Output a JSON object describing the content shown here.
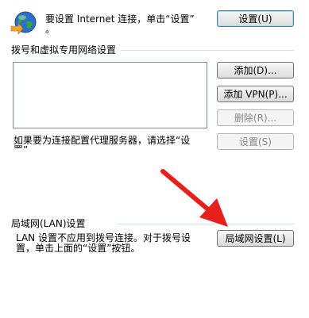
{
  "setup": {
    "text_line1": "要设置 Internet 连接，单击“设置”",
    "text_line2": "。",
    "button": "设置(U)"
  },
  "dialup": {
    "heading": "拨号和虚拟专用网络设置",
    "buttons": {
      "add": "添加(D)...",
      "add_vpn": "添加 VPN(P)...",
      "remove": "删除(R)...",
      "settings": "设置(S)"
    },
    "proxy_text_line1": "如果要为连接配置代理服务器，请选择“设",
    "proxy_text_line2": "置”。"
  },
  "lan": {
    "heading": "局域网(LAN)设置",
    "text_line1": "LAN 设置不应用到拨号连接。对于拨号设",
    "text_line2": "置，单击上面的“设置”按钮。",
    "button": "局域网设置(L)"
  },
  "colors": {
    "annotation_arrow": "#e8201b",
    "separator": "#d5dfe5"
  }
}
